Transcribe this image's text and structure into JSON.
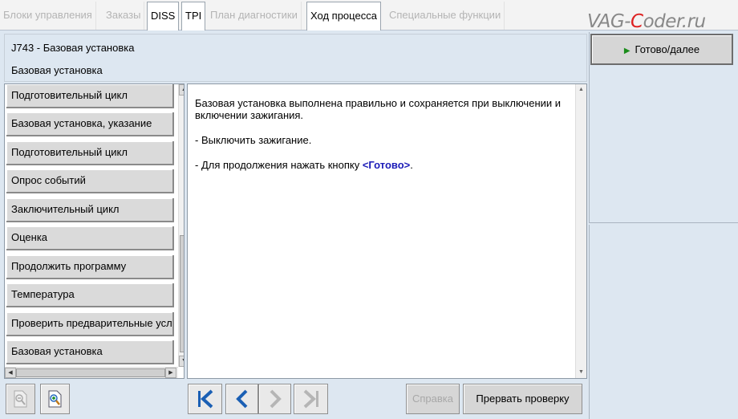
{
  "tabs": [
    {
      "label": "Блоки управления",
      "active": false
    },
    {
      "label": "Заказы",
      "active": false
    },
    {
      "label": "DISS",
      "active": true
    },
    {
      "label": "TPI",
      "active": true
    },
    {
      "label": "План диагностики",
      "active": false
    },
    {
      "label": "Ход процесса",
      "active": true
    },
    {
      "label": "Специальные функции",
      "active": false
    }
  ],
  "watermark": {
    "part1": "VAG-",
    "part2": "C",
    "part3": "oder.ru"
  },
  "header": {
    "line1": "J743 - Базовая установка",
    "line2": "Базовая установка"
  },
  "right": {
    "ready_label": "Готово/далее",
    "ready_icon": "play-icon"
  },
  "list": {
    "items": [
      "Подготовительный цикл",
      "Базовая установка, указание",
      "Подготовительный цикл",
      "Опрос событий",
      "Заключительный цикл",
      "Оценка",
      "Продолжить программу",
      "Температура",
      "Проверить предварительные условия",
      "Базовая установка"
    ]
  },
  "message": {
    "para1": "Базовая установка выполнена правильно и сохраняется при выключении и включении зажигания.",
    "para2": "- Выключить зажигание.",
    "para3_prefix": "- Для продолжения нажать кнопку ",
    "para3_link": "<Готово>",
    "para3_suffix": "."
  },
  "toolbar": {
    "zoom_out_icon": "zoom-out-icon",
    "zoom_in_icon": "zoom-in-icon",
    "first_icon": "skip-first-icon",
    "prev_icon": "prev-icon",
    "next_icon": "next-icon",
    "last_icon": "skip-last-icon",
    "help_label": "Справка",
    "abort_label": "Прервать проверку"
  },
  "colors": {
    "accent_blue": "#1a5fb4",
    "link_blue": "#1c1cb8",
    "play_green": "#1a8c1a",
    "watermark_red": "#dd2222"
  }
}
